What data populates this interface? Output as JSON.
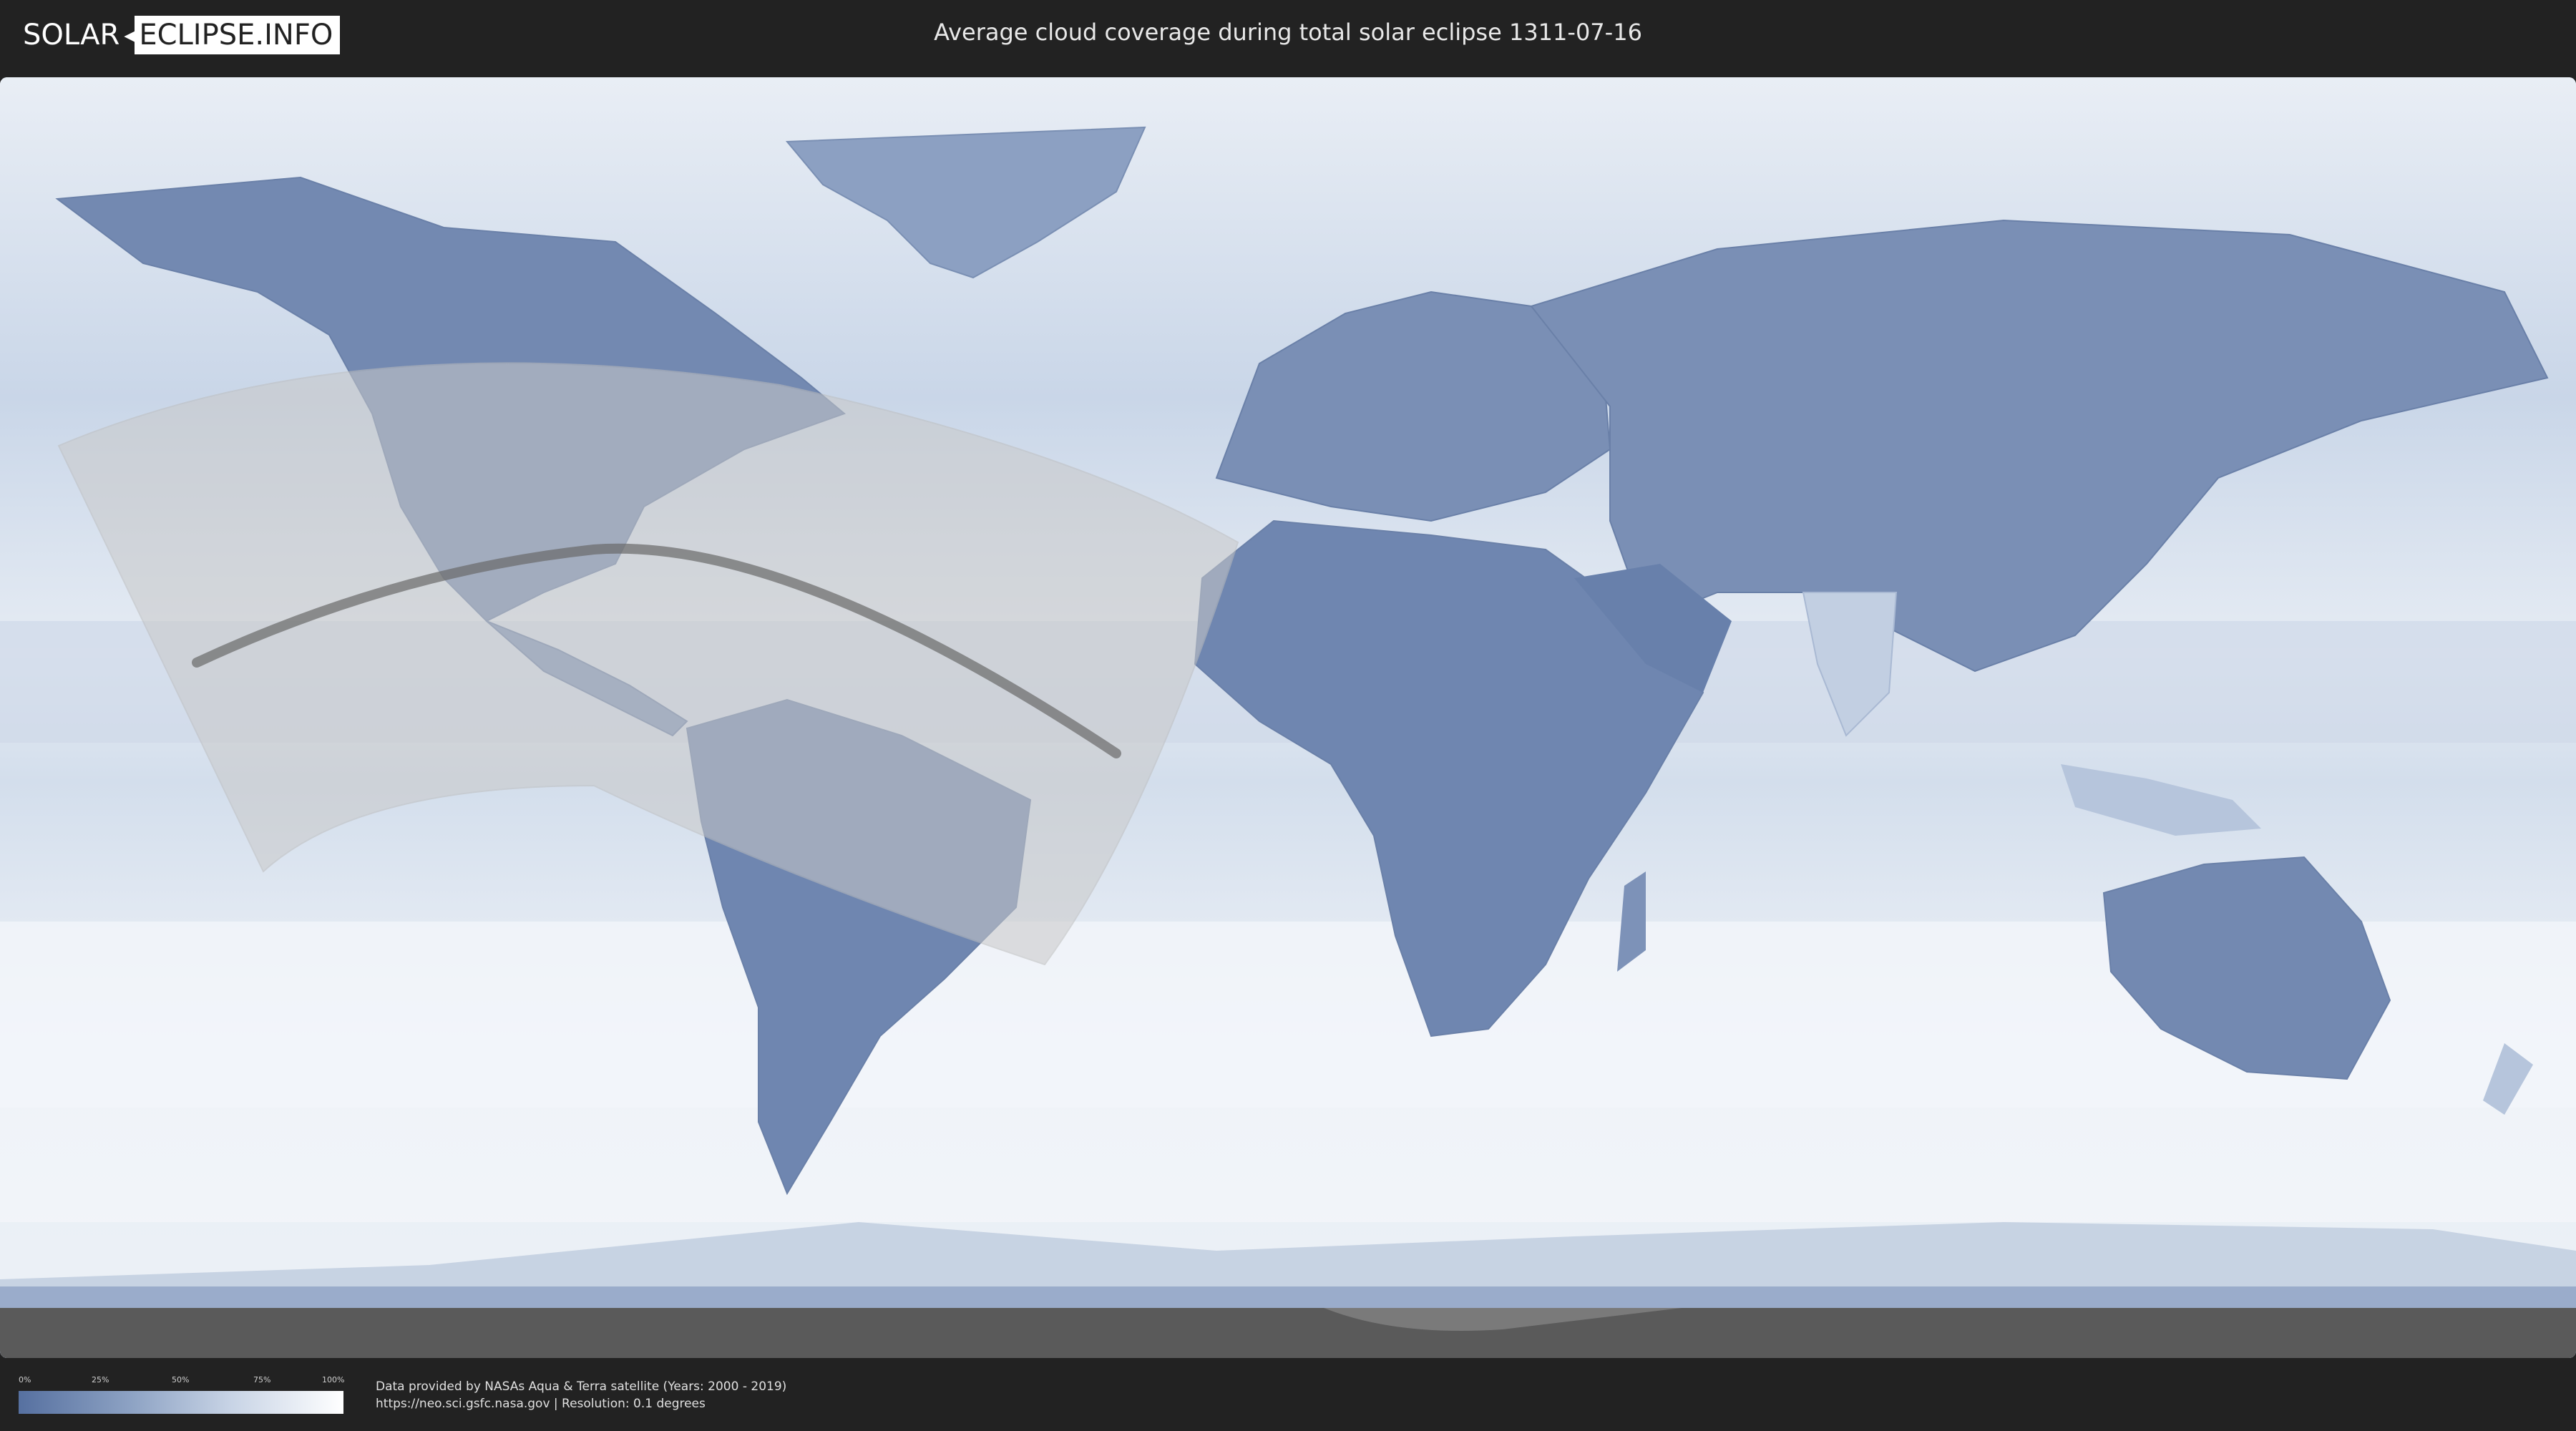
{
  "header": {
    "logo_solar": "SOLAR",
    "logo_rest": "ECLIPSE.INFO",
    "title": "Average cloud coverage during total solar eclipse 1311-07-16"
  },
  "legend": {
    "ticks": [
      "0%",
      "25%",
      "50%",
      "75%",
      "100%"
    ],
    "color_low": "#5670a0",
    "color_high": "#ffffff"
  },
  "footer": {
    "credit_line1": "Data provided by NASAs Aqua & Terra satellite (Years: 2000 - 2019)",
    "credit_line2": "https://neo.sci.gsfc.nasa.gov | Resolution: 0.1 degrees"
  },
  "map": {
    "background_color": "#dfe7f1",
    "land_color": "#6f86b0",
    "eclipse_zone_color": "#c9c9c9",
    "totality_path_color": "#6a6a6a"
  }
}
